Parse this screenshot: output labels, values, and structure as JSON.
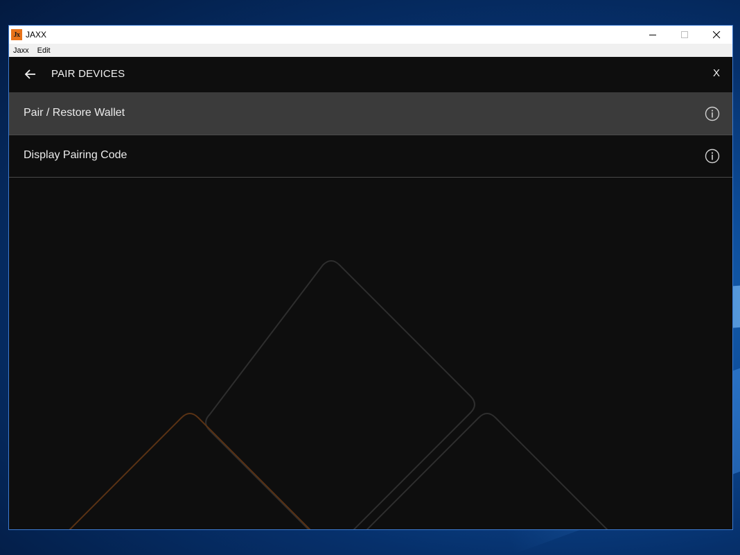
{
  "window": {
    "title": "JAXX",
    "logo_text": "Jx"
  },
  "menubar": {
    "items": [
      "Jaxx",
      "Edit"
    ]
  },
  "header": {
    "title": "PAIR DEVICES",
    "close_label": "X"
  },
  "options": [
    {
      "label": "Pair / Restore Wallet",
      "active": true
    },
    {
      "label": "Display Pairing Code",
      "active": false
    }
  ],
  "icons": {
    "back": "arrow-left-icon",
    "info": "info-circle-icon",
    "minimize": "minimize-icon",
    "maximize": "maximize-icon",
    "close": "close-icon"
  },
  "colors": {
    "app_background": "#0e0e0e",
    "active_row": "#3b3b3b",
    "logo": "#e8731a",
    "text": "#ececec",
    "decor_orange": "#5a3214",
    "decor_gray": "#2e2e2e"
  }
}
